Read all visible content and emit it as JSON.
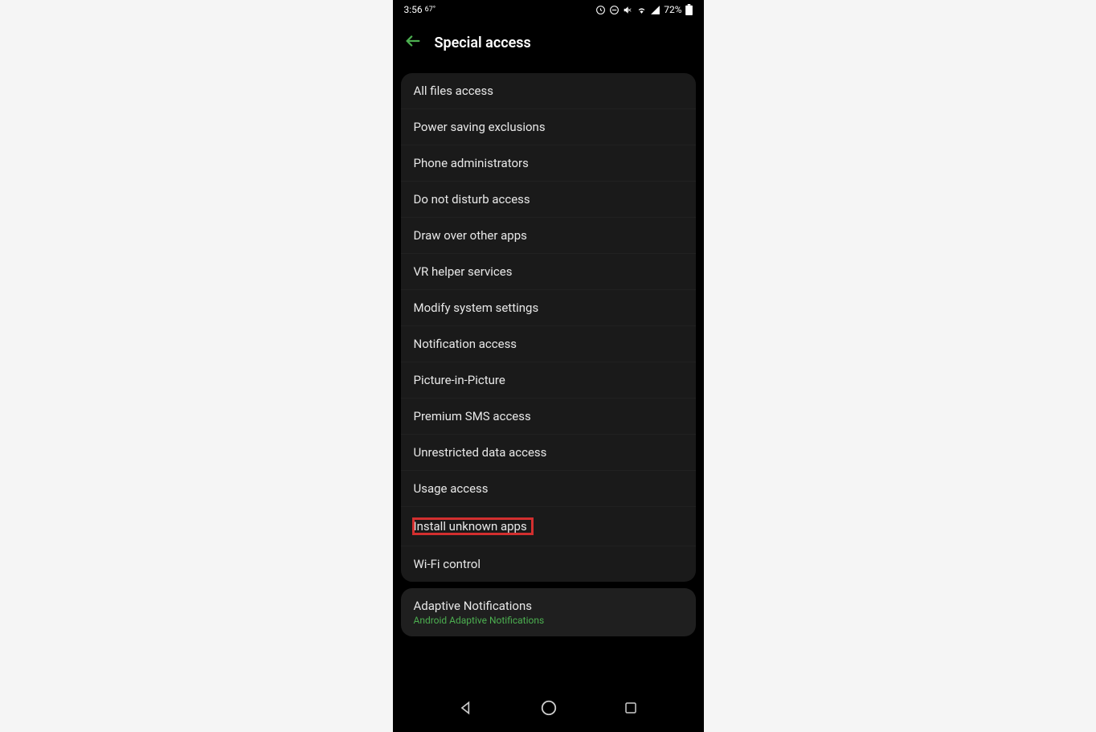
{
  "status_bar": {
    "time": "3:56",
    "temp": "67°",
    "battery": "72%"
  },
  "header": {
    "title": "Special access"
  },
  "settings": {
    "items": [
      {
        "label": "All files access"
      },
      {
        "label": "Power saving exclusions"
      },
      {
        "label": "Phone administrators"
      },
      {
        "label": "Do not disturb access"
      },
      {
        "label": "Draw over other apps"
      },
      {
        "label": "VR helper services"
      },
      {
        "label": "Modify system settings"
      },
      {
        "label": "Notification access"
      },
      {
        "label": "Picture-in-Picture"
      },
      {
        "label": "Premium SMS access"
      },
      {
        "label": "Unrestricted data access"
      },
      {
        "label": "Usage access"
      },
      {
        "label": "Install unknown apps"
      },
      {
        "label": "Wi-Fi control"
      }
    ]
  },
  "adaptive": {
    "title": "Adaptive Notifications",
    "subtitle": "Android Adaptive Notifications"
  }
}
